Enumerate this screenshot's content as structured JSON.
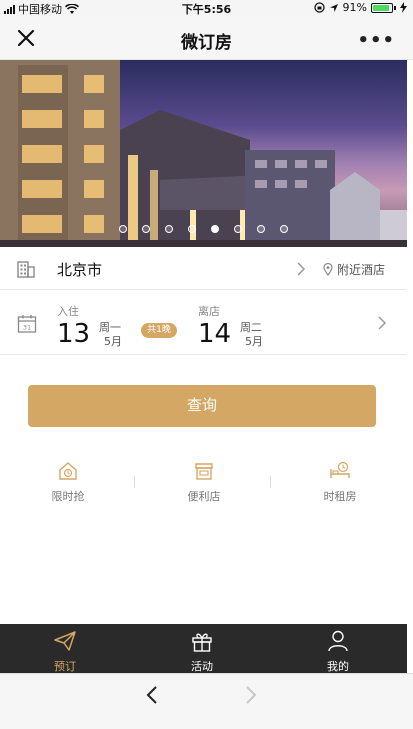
{
  "status_bar": {
    "carrier": "中国移动",
    "time": "下午5:56",
    "battery_percent": "91%",
    "battery_level": 0.91
  },
  "navbar": {
    "title": "微订房",
    "more_label": "•••"
  },
  "banner": {
    "dot_count": 8,
    "active_dot": 4
  },
  "location": {
    "city": "北京市",
    "nearby_label": "附近酒店"
  },
  "dates": {
    "checkin_label": "入住",
    "checkin_day": "13",
    "checkin_weekday": "周一",
    "checkin_month": "5月",
    "nights_label": "共1晚",
    "checkout_label": "离店",
    "checkout_day": "14",
    "checkout_weekday": "周二",
    "checkout_month": "5月"
  },
  "search_button": "查询",
  "quick_links": [
    {
      "label": "限时抢",
      "icon": "house-clock-icon"
    },
    {
      "label": "便利店",
      "icon": "store-icon"
    },
    {
      "label": "时租房",
      "icon": "bed-clock-icon"
    }
  ],
  "tabbar": {
    "items": [
      {
        "label": "预订",
        "icon": "paper-plane-icon",
        "active": true
      },
      {
        "label": "活动",
        "icon": "gift-icon",
        "active": false
      },
      {
        "label": "我的",
        "icon": "person-icon",
        "active": false
      }
    ]
  },
  "colors": {
    "accent": "#d4a765",
    "tabbar_bg": "#2a2a2a"
  }
}
